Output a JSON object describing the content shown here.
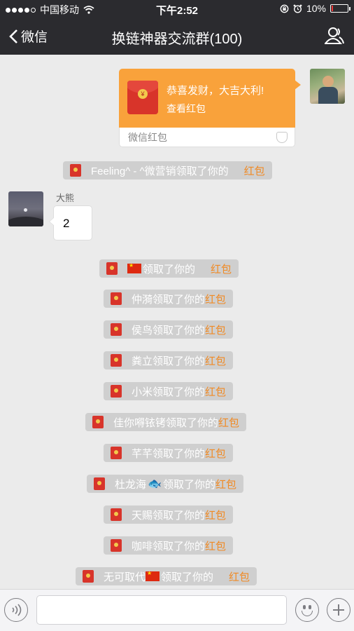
{
  "status_bar": {
    "carrier": "中国移动",
    "time": "下午2:52",
    "battery": "10%",
    "battery_level": 0.1,
    "signal_bars": 4,
    "signal_max": 5
  },
  "header": {
    "back_label": "微信",
    "title": "换链神器交流群(100)",
    "profile_icon": "group-profile-icon"
  },
  "red_packet": {
    "greeting": "恭喜发财，大吉大利!",
    "view_label": "查看红包",
    "footer_label": "微信红包",
    "coin_symbol": "¥"
  },
  "message": {
    "sender": "大熊",
    "text": "2"
  },
  "notices": [
    {
      "prefix": "",
      "flag": true,
      "fish": false,
      "name": "",
      "suffix": "领取了你的",
      "link": "红包",
      "gap": true
    },
    {
      "prefix": "",
      "flag": false,
      "fish": false,
      "name": "仲漪",
      "suffix": "领取了你的",
      "link": "红包",
      "gap": false
    },
    {
      "prefix": "",
      "flag": false,
      "fish": false,
      "name": "侯鸟",
      "suffix": "领取了你的",
      "link": "红包",
      "gap": false
    },
    {
      "prefix": "",
      "flag": false,
      "fish": false,
      "name": "粪立",
      "suffix": "领取了你的",
      "link": "红包",
      "gap": false
    },
    {
      "prefix": "",
      "flag": false,
      "fish": false,
      "name": "小米",
      "suffix": "领取了你的",
      "link": "红包",
      "gap": false
    },
    {
      "prefix": "",
      "flag": false,
      "fish": false,
      "name": "佳你嘚铱铐",
      "suffix": "领取了你的",
      "link": "红包",
      "gap": false
    },
    {
      "prefix": "",
      "flag": false,
      "fish": false,
      "name": "芊芊",
      "suffix": "领取了你的",
      "link": "红包",
      "gap": false
    },
    {
      "prefix": "",
      "flag": false,
      "fish": true,
      "name": "杜龙海",
      "suffix": "领取了你的",
      "link": "红包",
      "gap": false
    },
    {
      "prefix": "",
      "flag": false,
      "fish": false,
      "name": "天赐",
      "suffix": "领取了你的",
      "link": "红包",
      "gap": false
    },
    {
      "prefix": "",
      "flag": false,
      "fish": false,
      "name": "咖啡",
      "suffix": "领取了你的",
      "link": "红包",
      "gap": false
    },
    {
      "prefix": "",
      "flag": true,
      "fish": false,
      "name": "无可取代",
      "suffix": "领取了你的",
      "link": "红包",
      "gap": true
    }
  ],
  "first_notice": {
    "name": "Feeling^ - ^微营销",
    "suffix": "领取了你的",
    "link": "红包"
  },
  "input_bar": {
    "voice_icon": "voice-icon",
    "emoji_icon": "emoji-icon",
    "plus_icon": "plus-icon",
    "placeholder": ""
  },
  "colors": {
    "navbar": "#2b2b2f",
    "background": "#ebebeb",
    "red_packet": "#f9a23b",
    "notice_bg": "#cfcfcf",
    "highlight": "#f08a24"
  }
}
